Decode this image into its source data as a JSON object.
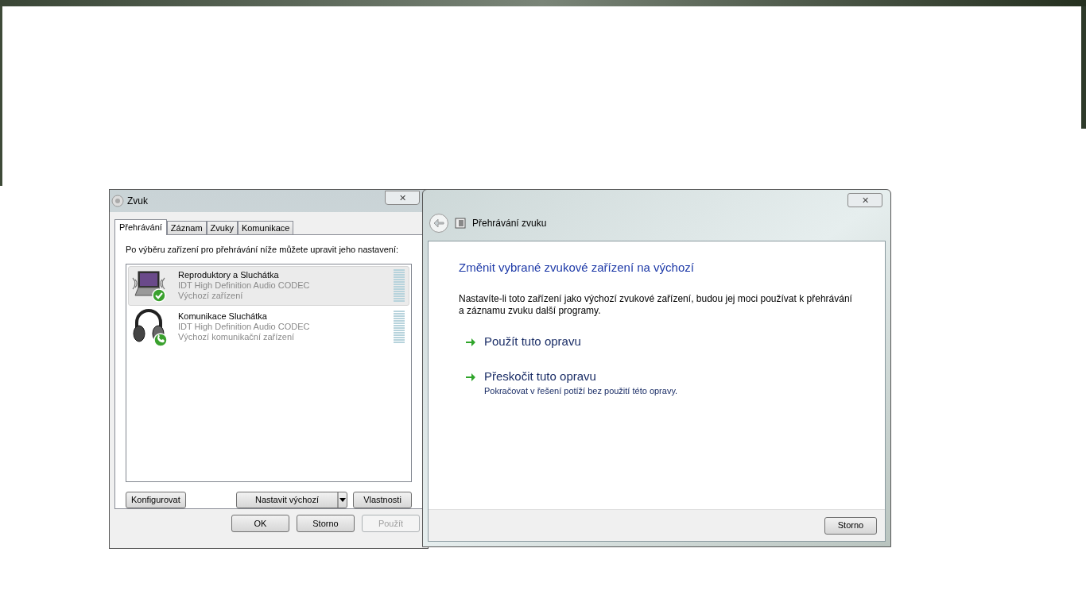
{
  "sound_dialog": {
    "title": "Zvuk",
    "close": "✕",
    "tabs": [
      {
        "label": "Přehrávání",
        "selected": true
      },
      {
        "label": "Záznam",
        "selected": false
      },
      {
        "label": "Zvuky",
        "selected": false
      },
      {
        "label": "Komunikace",
        "selected": false
      }
    ],
    "instruction": "Po výběru zařízení pro přehrávání níže můžete upravit jeho nastavení:",
    "devices": [
      {
        "kind": "laptop",
        "name": "Reproduktory a Sluchátka",
        "driver": "IDT High Definition Audio CODEC",
        "status": "Výchozí zařízení",
        "selected": true
      },
      {
        "kind": "headphones",
        "name": "Komunikace Sluchátka",
        "driver": "IDT High Definition Audio CODEC",
        "status": "Výchozí komunikační zařízení",
        "selected": false
      }
    ],
    "configure_button": "Konfigurovat",
    "set_default_button": "Nastavit výchozí",
    "properties_button": "Vlastnosti",
    "footer_buttons": [
      {
        "label": "OK",
        "disabled": false
      },
      {
        "label": "Storno",
        "disabled": false
      },
      {
        "label": "Použít",
        "disabled": true
      }
    ]
  },
  "troubleshooter": {
    "close": "✕",
    "title": "Přehrávání zvuku",
    "heading": "Změnit vybrané zvukové zařízení na výchozí",
    "description": "Nastavíte-li toto zařízení jako výchozí zvukové zařízení, budou jej moci používat k přehrávání a záznamu zvuku další programy.",
    "options": [
      {
        "title": "Použít tuto opravu"
      },
      {
        "title": "Přeskočit tuto opravu",
        "description": "Pokračovat v řešení potíží bez použití této opravy."
      }
    ],
    "cancel_button": "Storno"
  }
}
